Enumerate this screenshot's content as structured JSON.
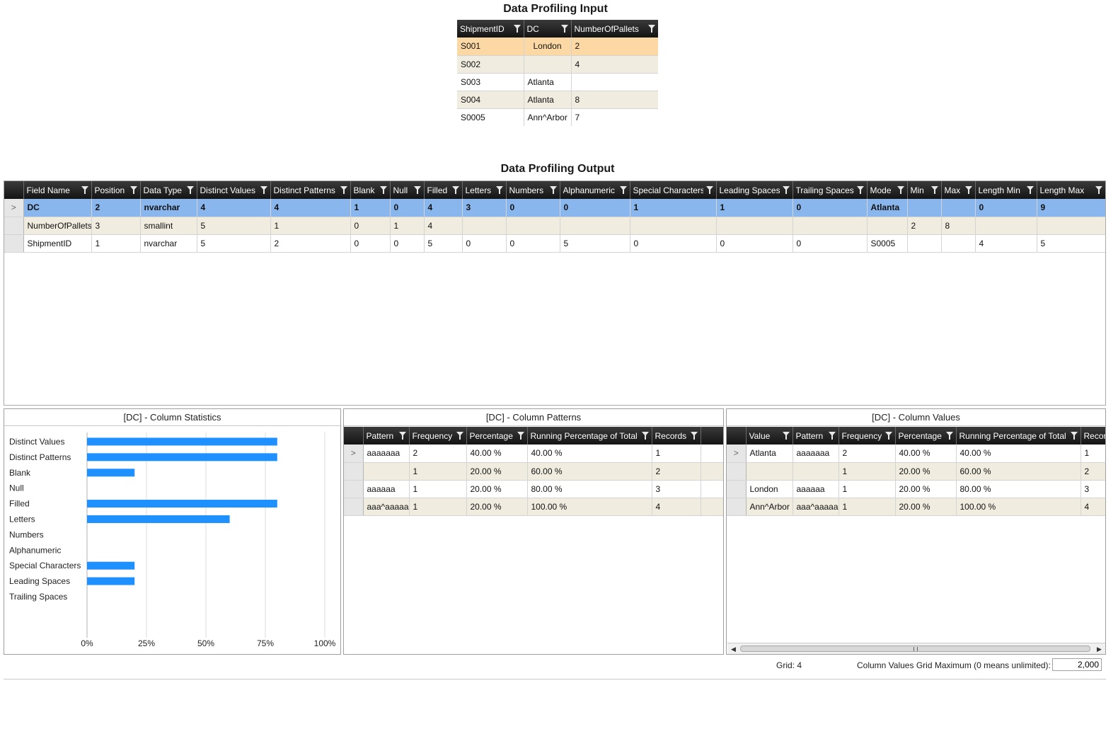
{
  "input": {
    "title": "Data Profiling Input",
    "columns": [
      "ShipmentID",
      "DC",
      "NumberOfPallets"
    ],
    "rows": [
      [
        "S001",
        "London",
        "2"
      ],
      [
        "S002",
        "",
        "4"
      ],
      [
        "S003",
        "Atlanta",
        ""
      ],
      [
        "S004",
        "Atlanta",
        "8"
      ],
      [
        "S0005",
        "Ann^Arbor",
        "7"
      ]
    ]
  },
  "output": {
    "title": "Data Profiling Output",
    "columns": [
      "Field Name",
      "Position",
      "Data Type",
      "Distinct Values",
      "Distinct Patterns",
      "Blank",
      "Null",
      "Filled",
      "Letters",
      "Numbers",
      "Alphanumeric",
      "Special Characters",
      "Leading Spaces",
      "Trailing Spaces",
      "Mode",
      "Min",
      "Max",
      "Length Min",
      "Length Max"
    ],
    "rows": [
      [
        "DC",
        "2",
        "nvarchar",
        "4",
        "4",
        "1",
        "0",
        "4",
        "3",
        "0",
        "0",
        "1",
        "1",
        "0",
        "Atlanta",
        "",
        "",
        "0",
        "9"
      ],
      [
        "NumberOfPallets",
        "3",
        "smallint",
        "5",
        "1",
        "0",
        "1",
        "4",
        "",
        "",
        "",
        "",
        "",
        "",
        "",
        "2",
        "8",
        "",
        ""
      ],
      [
        "ShipmentID",
        "1",
        "nvarchar",
        "5",
        "2",
        "0",
        "0",
        "5",
        "0",
        "0",
        "5",
        "0",
        "0",
        "0",
        "S0005",
        "",
        "",
        "4",
        "5"
      ]
    ],
    "row_indicator": ">"
  },
  "stats": {
    "title": "[DC] - Column Statistics",
    "chart_data": {
      "type": "bar",
      "orientation": "horizontal",
      "categories": [
        "Distinct Values",
        "Distinct Patterns",
        "Blank",
        "Null",
        "Filled",
        "Letters",
        "Numbers",
        "Alphanumeric",
        "Special Characters",
        "Leading Spaces",
        "Trailing Spaces"
      ],
      "values": [
        80,
        80,
        20,
        0,
        80,
        60,
        0,
        0,
        20,
        20,
        0
      ],
      "xticks": [
        "0%",
        "25%",
        "50%",
        "75%",
        "100%"
      ],
      "xlim": [
        0,
        100
      ],
      "grid": true,
      "bar_color": "#1e90ff"
    }
  },
  "patterns": {
    "title": "[DC] -  Column Patterns",
    "columns": [
      "Pattern",
      "Frequency",
      "Percentage",
      "Running Percentage of Total",
      "Records"
    ],
    "rows": [
      [
        "aaaaaaa",
        "2",
        "40.00 %",
        "40.00 %",
        "1"
      ],
      [
        "",
        "1",
        "20.00 %",
        "60.00 %",
        "2"
      ],
      [
        " aaaaaa",
        "1",
        "20.00 %",
        "80.00 %",
        "3"
      ],
      [
        "aaa^aaaaa",
        "1",
        "20.00 %",
        "100.00 %",
        "4"
      ]
    ]
  },
  "values": {
    "title": "[DC] -  Column Values",
    "columns": [
      "Value",
      "Pattern",
      "Frequency",
      "Percentage",
      "Running Percentage of Total",
      "Recor"
    ],
    "rows": [
      [
        "Atlanta",
        "aaaaaaa",
        "2",
        "40.00 %",
        "40.00 %",
        "1"
      ],
      [
        "",
        "",
        "1",
        "20.00 %",
        "60.00 %",
        "2"
      ],
      [
        " London",
        " aaaaaa",
        "1",
        "20.00 %",
        "80.00 %",
        "3"
      ],
      [
        "Ann^Arbor",
        "aaa^aaaaa",
        "1",
        "20.00 %",
        "100.00 %",
        "4"
      ]
    ]
  },
  "status": {
    "grid_label": "Grid: 4",
    "max_label": "Column Values Grid Maximum (0 means unlimited):",
    "max_value": "2,000"
  }
}
